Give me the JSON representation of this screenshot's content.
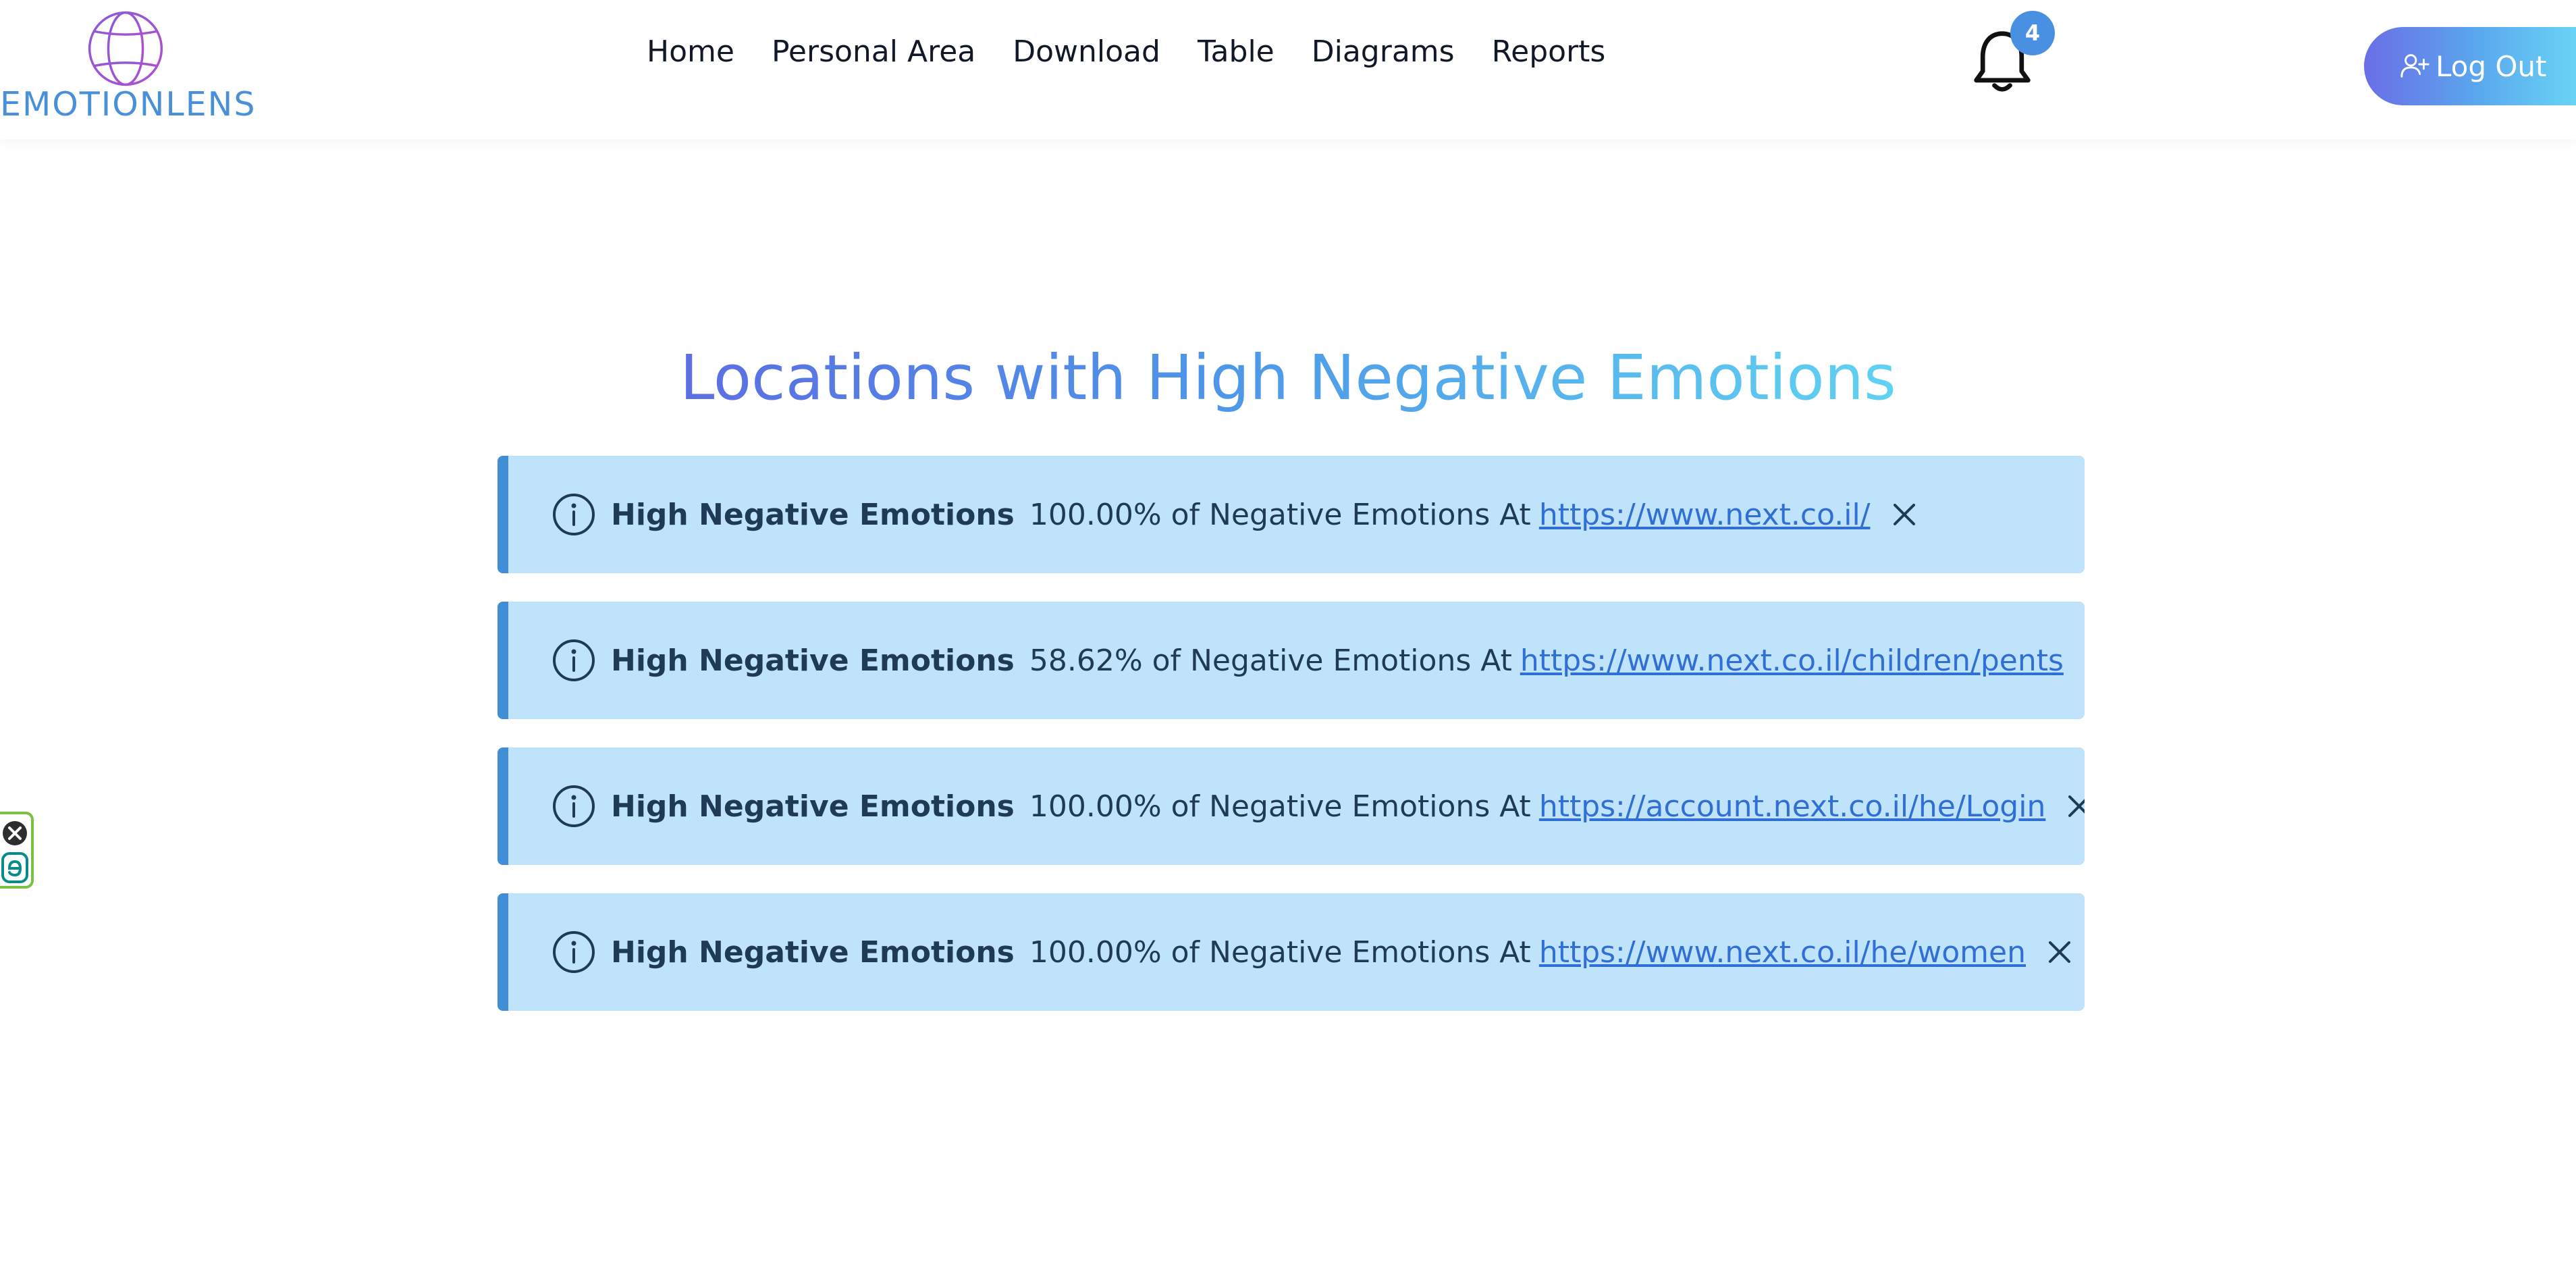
{
  "header": {
    "logo_text": "EMOTIONLENS",
    "nav": [
      "Home",
      "Personal Area",
      "Download",
      "Table",
      "Diagrams",
      "Reports"
    ],
    "notification_count": "4",
    "logout_label": "Log Out"
  },
  "main": {
    "title": "Locations with High Negative Emotions",
    "alerts": [
      {
        "title": "High Negative Emotions",
        "message": "100.00% of Negative Emotions At",
        "url": "https://www.next.co.il/"
      },
      {
        "title": "High Negative Emotions",
        "message": "58.62% of Negative Emotions At",
        "url": "https://www.next.co.il/children/pents"
      },
      {
        "title": "High Negative Emotions",
        "message": "100.00% of Negative Emotions At",
        "url": "https://account.next.co.il/he/Login"
      },
      {
        "title": "High Negative Emotions",
        "message": "100.00% of Negative Emotions At",
        "url": "https://www.next.co.il/he/women"
      }
    ]
  },
  "icons": {
    "logo": "globe-icon",
    "notification": "bell-icon",
    "logout": "user-plus-icon",
    "alert": "info-circle-icon",
    "dismiss": "close-icon",
    "side_widget": [
      "close-circle-icon",
      "e-letter-icon"
    ]
  },
  "colors": {
    "brand_blue": "#4a90d9",
    "alert_bg": "#bfe3fa",
    "alert_accent": "#3f8ed6",
    "link": "#2f6fd6",
    "badge": "#4a90e2",
    "side_widget_border": "#7ac143"
  }
}
